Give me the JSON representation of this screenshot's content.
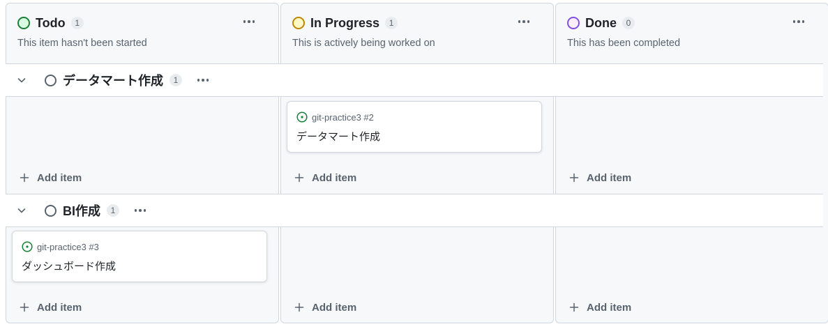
{
  "colors": {
    "todo": "#1a7f37",
    "in_progress": "#bf8700",
    "done": "#8250df",
    "muted": "#59636e",
    "issue_open": "#1a7f37"
  },
  "columns": [
    {
      "title": "Todo",
      "count": "1",
      "description": "This item hasn't been started"
    },
    {
      "title": "In Progress",
      "count": "1",
      "description": "This is actively being worked on"
    },
    {
      "title": "Done",
      "count": "0",
      "description": "This has been completed"
    }
  ],
  "groups": [
    {
      "title": "データマート作成",
      "count": "1",
      "card": {
        "repo": "git-practice3 #2",
        "title": "データマート作成"
      }
    },
    {
      "title": "BI作成",
      "count": "1",
      "card": {
        "repo": "git-practice3 #3",
        "title": "ダッシュボード作成"
      }
    }
  ],
  "add_item_label": "Add item",
  "icons": {
    "column_status": "circle-icon",
    "more": "kebab-horizontal-icon",
    "collapse": "chevron-down-icon",
    "issue": "issue-opened-icon",
    "add": "plus-icon"
  }
}
